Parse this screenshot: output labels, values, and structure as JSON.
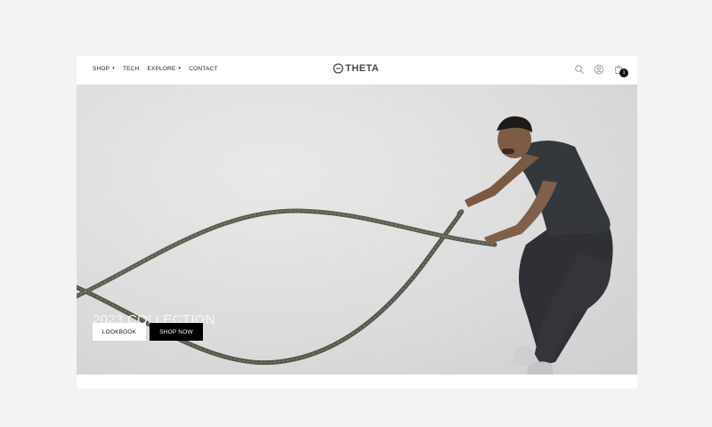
{
  "nav": {
    "items": [
      {
        "label": "SHOP",
        "has_caret": true
      },
      {
        "label": "TECH",
        "has_caret": false
      },
      {
        "label": "EXPLORE",
        "has_caret": true
      },
      {
        "label": "CONTACT",
        "has_caret": false
      }
    ],
    "caret_glyph": "▾",
    "brand": "THETA",
    "icons": [
      "search-icon",
      "account-icon",
      "cart-icon"
    ],
    "cart_count": "1"
  },
  "hero": {
    "title": "2023 COLLECTION",
    "lookbook_label": "LOOKBOOK",
    "shop_now_label": "SHOP NOW"
  },
  "colors": {
    "background": "#f3f3f3",
    "page": "#ffffff",
    "text": "#222222",
    "button_dark": "#000000",
    "hero_background": "#dcdcdc"
  }
}
